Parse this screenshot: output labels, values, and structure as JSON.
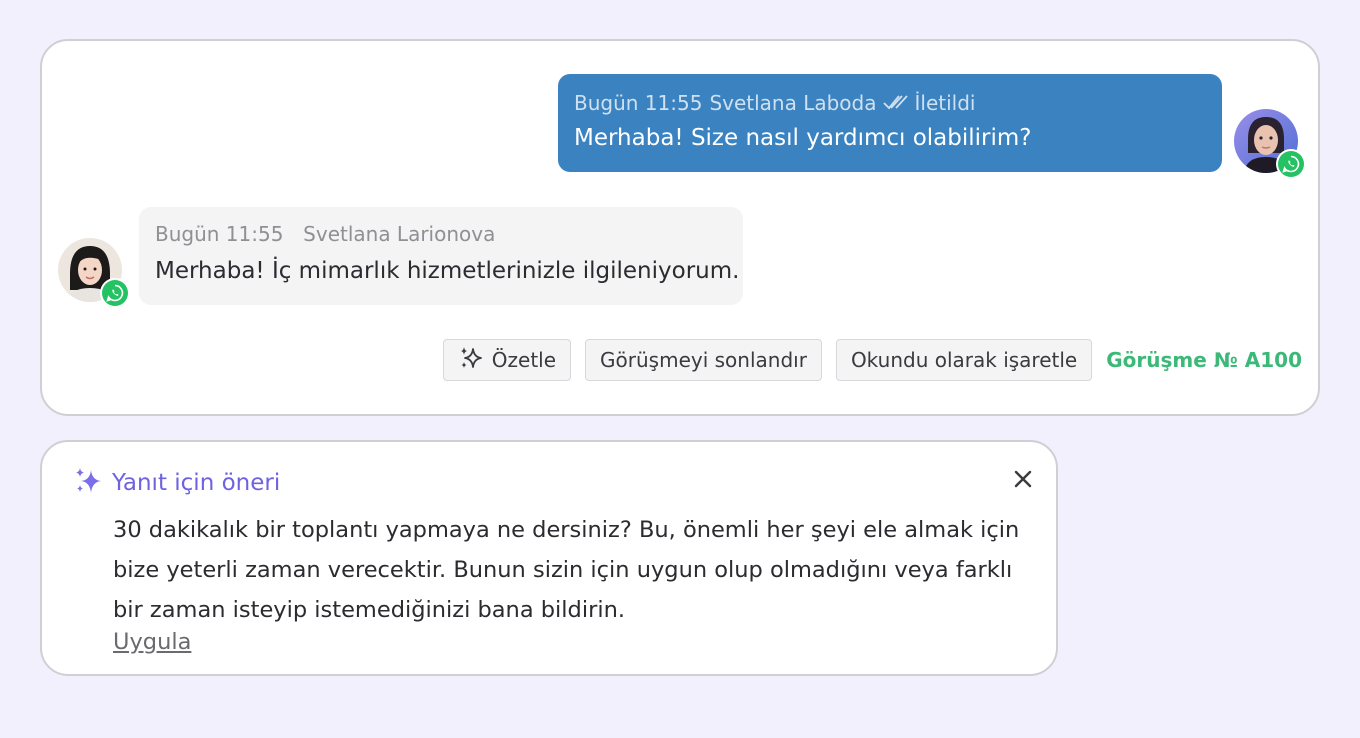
{
  "chat": {
    "outgoing": {
      "time": "Bugün 11:55",
      "author": "Svetlana Laboda",
      "status": "İletildi",
      "text": "Merhaba! Size nasıl yardımcı olabilirim?",
      "bubble_color": "#3a82c0"
    },
    "incoming": {
      "time": "Bugün 11:55",
      "author": "Svetlana Larionova",
      "text": "Merhaba! İç mimarlık hizmetlerinizle ilgileniyorum."
    },
    "channel_icon": "whatsapp-icon",
    "actions": {
      "summarize_label": "Özetle",
      "end_label": "Görüşmeyi sonlandır",
      "mark_read_label": "Okundu olarak işaretle"
    },
    "conversation_label": "Görüşme № A100",
    "conversation_label_color": "#3cb878"
  },
  "suggestion": {
    "title": "Yanıt için öneri",
    "text": "30 dakikalık bir toplantı yapmaya ne dersiniz? Bu, önemli her şeyi ele almak için bize yeterli zaman verecektir. Bunun sizin için uygun olup olmadığını veya farklı bir zaman isteyip istemediğinizi bana bildirin.",
    "apply_label": "Uygula",
    "accent_color": "#6f62e0"
  }
}
